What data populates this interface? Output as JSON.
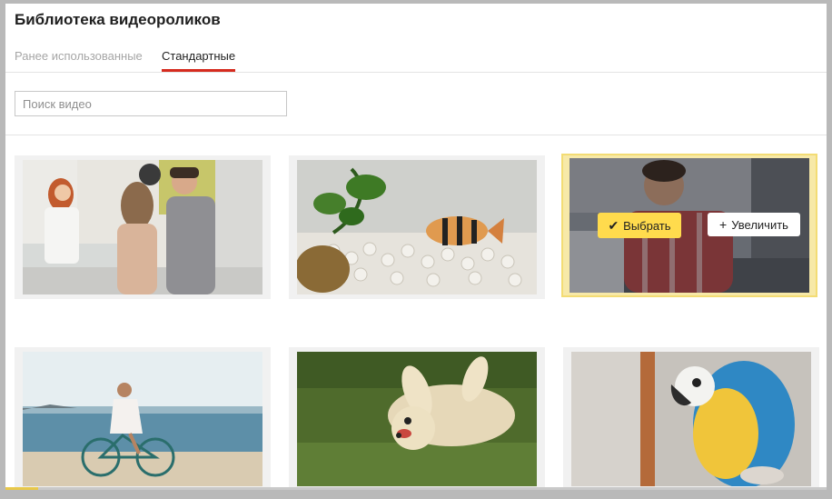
{
  "header": {
    "title": "Библиотека видеороликов"
  },
  "tabs": [
    {
      "label": "Ранее использованные",
      "active": false
    },
    {
      "label": "Стандартные",
      "active": true
    }
  ],
  "search": {
    "placeholder": "Поиск видео",
    "value": ""
  },
  "videos": [
    {
      "subject": "pharmacy",
      "selected": false
    },
    {
      "subject": "aquarium-fish",
      "selected": false
    },
    {
      "subject": "man-at-laptop",
      "selected": true,
      "actions": {
        "choose_label": "Выбрать",
        "choose_icon": "check-icon",
        "zoom_label": "Увеличить",
        "zoom_icon": "plus-icon"
      }
    },
    {
      "subject": "girl-on-bicycle-beach",
      "selected": false
    },
    {
      "subject": "dog-rolling-grass",
      "selected": false
    },
    {
      "subject": "parrot",
      "selected": false
    }
  ],
  "colors": {
    "accent_tab": "#d62b1f",
    "choose_button": "#ffdb4d",
    "selected_border": "#f3dc74"
  }
}
